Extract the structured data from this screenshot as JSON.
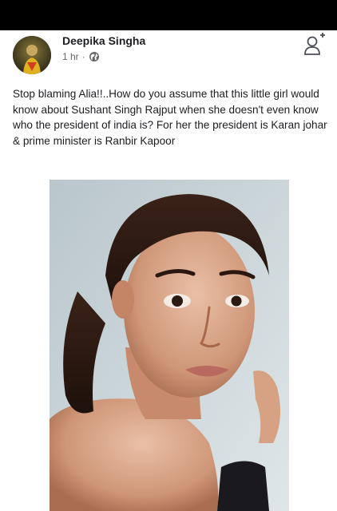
{
  "post": {
    "author_name": "Deepika Singha",
    "timestamp": "1 hr",
    "separator": "·",
    "privacy_icon": "globe-icon",
    "action_icon": "add-friend-icon",
    "text": "Stop blaming Alia!!..How do you assume that this little girl would know about Sushant Singh Rajput when she doesn't even know who the president of india is? For her the president is Karan johar & prime minister is  Ranbir Kapoor"
  },
  "colors": {
    "status_bar": "#000000",
    "background": "#ffffff",
    "text_primary": "#1c1e21",
    "text_secondary": "#65676b"
  }
}
